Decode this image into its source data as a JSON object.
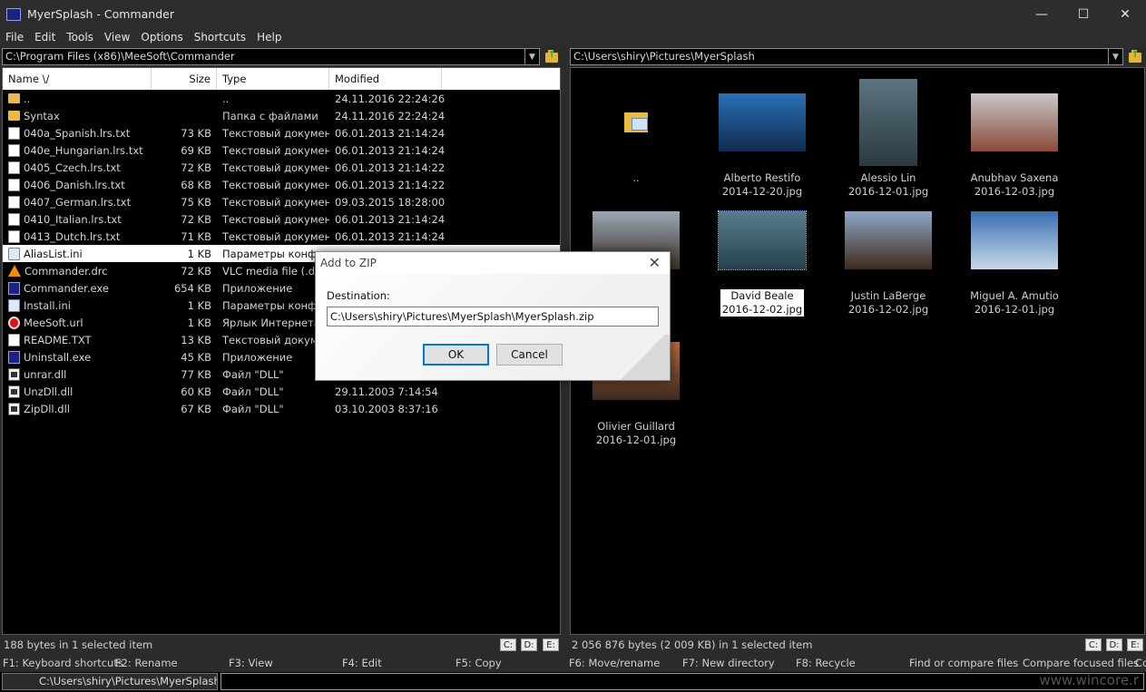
{
  "window": {
    "title": "MyerSplash - Commander"
  },
  "menu": [
    "File",
    "Edit",
    "Tools",
    "View",
    "Options",
    "Shortcuts",
    "Help"
  ],
  "left": {
    "path": "C:\\Program Files (x86)\\MeeSoft\\Commander",
    "headers": {
      "name": "Name \\/",
      "size": "Size",
      "type": "Type",
      "modified": "Modified"
    },
    "rows": [
      {
        "icon": "folder",
        "name": "..",
        "size": "",
        "type": "..",
        "modified": "24.11.2016 22:24:26"
      },
      {
        "icon": "folder",
        "name": "Syntax",
        "size": "",
        "type": "Папка с файлами",
        "modified": "24.11.2016 22:24:24"
      },
      {
        "icon": "doc",
        "name": "040a_Spanish.lrs.txt",
        "size": "73 KB",
        "type": "Текстовый документ",
        "modified": "06.01.2013 21:14:24"
      },
      {
        "icon": "doc",
        "name": "040e_Hungarian.lrs.txt",
        "size": "69 KB",
        "type": "Текстовый документ",
        "modified": "06.01.2013 21:14:24"
      },
      {
        "icon": "doc",
        "name": "0405_Czech.lrs.txt",
        "size": "72 KB",
        "type": "Текстовый документ",
        "modified": "06.01.2013 21:14:22"
      },
      {
        "icon": "doc",
        "name": "0406_Danish.lrs.txt",
        "size": "68 KB",
        "type": "Текстовый документ",
        "modified": "06.01.2013 21:14:22"
      },
      {
        "icon": "doc",
        "name": "0407_German.lrs.txt",
        "size": "75 KB",
        "type": "Текстовый документ",
        "modified": "09.03.2015 18:28:00"
      },
      {
        "icon": "doc",
        "name": "0410_Italian.lrs.txt",
        "size": "72 KB",
        "type": "Текстовый документ",
        "modified": "06.01.2013 21:14:24"
      },
      {
        "icon": "doc",
        "name": "0413_Dutch.lrs.txt",
        "size": "71 KB",
        "type": "Текстовый документ",
        "modified": "06.01.2013 21:14:24"
      },
      {
        "icon": "ini",
        "name": "AliasList.ini",
        "size": "1 KB",
        "type": "Параметры конфи",
        "modified": "",
        "selected": true
      },
      {
        "icon": "vlc",
        "name": "Commander.drc",
        "size": "72 KB",
        "type": "VLC media file (.drc",
        "modified": ""
      },
      {
        "icon": "exe",
        "name": "Commander.exe",
        "size": "654 KB",
        "type": "Приложение",
        "modified": ""
      },
      {
        "icon": "ini",
        "name": "Install.ini",
        "size": "1 KB",
        "type": "Параметры конфи",
        "modified": ""
      },
      {
        "icon": "url",
        "name": "MeeSoft.url",
        "size": "1 KB",
        "type": "Ярлык Интернета",
        "modified": ""
      },
      {
        "icon": "doc",
        "name": "README.TXT",
        "size": "13 KB",
        "type": "Текстовый докум",
        "modified": ""
      },
      {
        "icon": "exe",
        "name": "Uninstall.exe",
        "size": "45 KB",
        "type": "Приложение",
        "modified": ""
      },
      {
        "icon": "dll",
        "name": "unrar.dll",
        "size": "77 KB",
        "type": "Файл \"DLL\"",
        "modified": ""
      },
      {
        "icon": "dll",
        "name": "UnzDll.dll",
        "size": "60 KB",
        "type": "Файл \"DLL\"",
        "modified": "29.11.2003 7:14:54"
      },
      {
        "icon": "dll",
        "name": "ZipDll.dll",
        "size": "67 KB",
        "type": "Файл \"DLL\"",
        "modified": "03.10.2003 8:37:16"
      }
    ],
    "status": "188 bytes in 1 selected item",
    "drives": [
      "C:",
      "D:",
      "E:"
    ]
  },
  "right": {
    "path": "C:\\Users\\shiry\\Pictures\\MyerSplash",
    "thumbs": [
      {
        "line1": "..",
        "line2": "",
        "kind": "folder"
      },
      {
        "line1": "Alberto Restifo",
        "line2": "2014-12-20.jpg",
        "colors": [
          "#2a6fb5",
          "#0f2c4f"
        ]
      },
      {
        "line1": "Alessio Lin",
        "line2": "2016-12-01.jpg",
        "colors": [
          "#5c7480",
          "#2b3a40"
        ]
      },
      {
        "line1": "Anubhav Saxena",
        "line2": "2016-12-03.jpg",
        "colors": [
          "#c8c8c8",
          "#8a4a3a"
        ]
      },
      {
        "line1": "",
        "line2": "03.jpg",
        "colors": [
          "#9aa8b6",
          "#3b3025"
        ]
      },
      {
        "line1": "David Beale",
        "line2": "2016-12-02.jpg",
        "colors": [
          "#5a7d8e",
          "#26424c"
        ],
        "selected": true
      },
      {
        "line1": "Justin LaBerge",
        "line2": "2016-12-02.jpg",
        "colors": [
          "#8ea7c7",
          "#3e2a1a"
        ]
      },
      {
        "line1": "Miguel A. Amutio",
        "line2": "2016-12-01.jpg",
        "colors": [
          "#3a6fb0",
          "#c9d8ea"
        ]
      },
      {
        "line1": "Olivier Guillard",
        "line2": "2016-12-01.jpg",
        "colors": [
          "#b96b3a",
          "#3a2a20"
        ]
      }
    ],
    "status": "2 056 876 bytes (2 009 KB) in 1 selected item",
    "drives": [
      "C:",
      "D:",
      "E:"
    ]
  },
  "fkeys": [
    "F1: Keyboard shortcuts",
    "F2: Rename",
    "F3: View",
    "F4: Edit",
    "F5: Copy",
    "F6: Move/rename",
    "F7: New directory",
    "F8: Recycle",
    "Find or compare files",
    "Compare focused files",
    "Co"
  ],
  "cmd": {
    "prompt": "C:\\Users\\shiry\\Pictures\\MyerSplash>"
  },
  "dialog": {
    "title": "Add to ZIP",
    "label": "Destination:",
    "value": "C:\\Users\\shiry\\Pictures\\MyerSplash\\MyerSplash.zip",
    "ok": "OK",
    "cancel": "Cancel"
  },
  "watermark": "www.wincore.r"
}
